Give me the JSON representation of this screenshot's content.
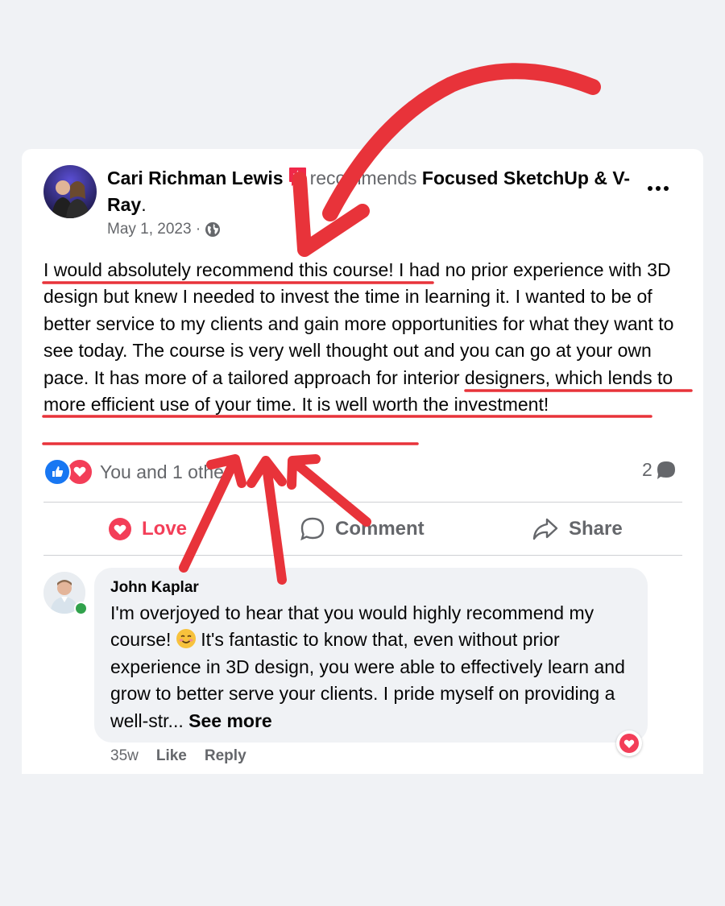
{
  "post": {
    "author": "Cari Richman Lewis",
    "verb": "recommends",
    "page": "Focused SketchUp & V-Ray",
    "period": ".",
    "date": "May 1, 2023 ·",
    "privacy_icon": "globe-icon",
    "more_icon": "more-options-icon",
    "body_segments": [
      "I would absolutely recommend this course!",
      "  I had no prior experience with 3D design but knew I needed to invest the time in learning it. I wanted to be of better service to my clients and gain more opportunities for what they want to see today.  The course is very well thought out and you can go at your own pace.  ",
      "It has more of a tailored approach for interior designers, which lends to more efficient use of your time.  It is well worth the investment!"
    ],
    "reactions_text": "You and 1 other",
    "comment_count": "2"
  },
  "actions": {
    "love": "Love",
    "comment": "Comment",
    "share": "Share"
  },
  "comment": {
    "author": "John Kaplar",
    "text_before_emoji": "I'm overjoyed to hear that you would highly recommend my course! ",
    "text_after_emoji": " It's fantastic to know that, even without prior experience in 3D design, you were able to effectively learn and grow to better serve your clients. I pride myself on providing a well-str... ",
    "see_more": "See more",
    "time": "35w",
    "like": "Like",
    "reply": "Reply"
  },
  "colors": {
    "background": "#f0f2f5",
    "annotation_red": "#e8333a",
    "love_pink": "#f33e58",
    "like_blue": "#1877f2",
    "muted_text": "#65676b"
  }
}
